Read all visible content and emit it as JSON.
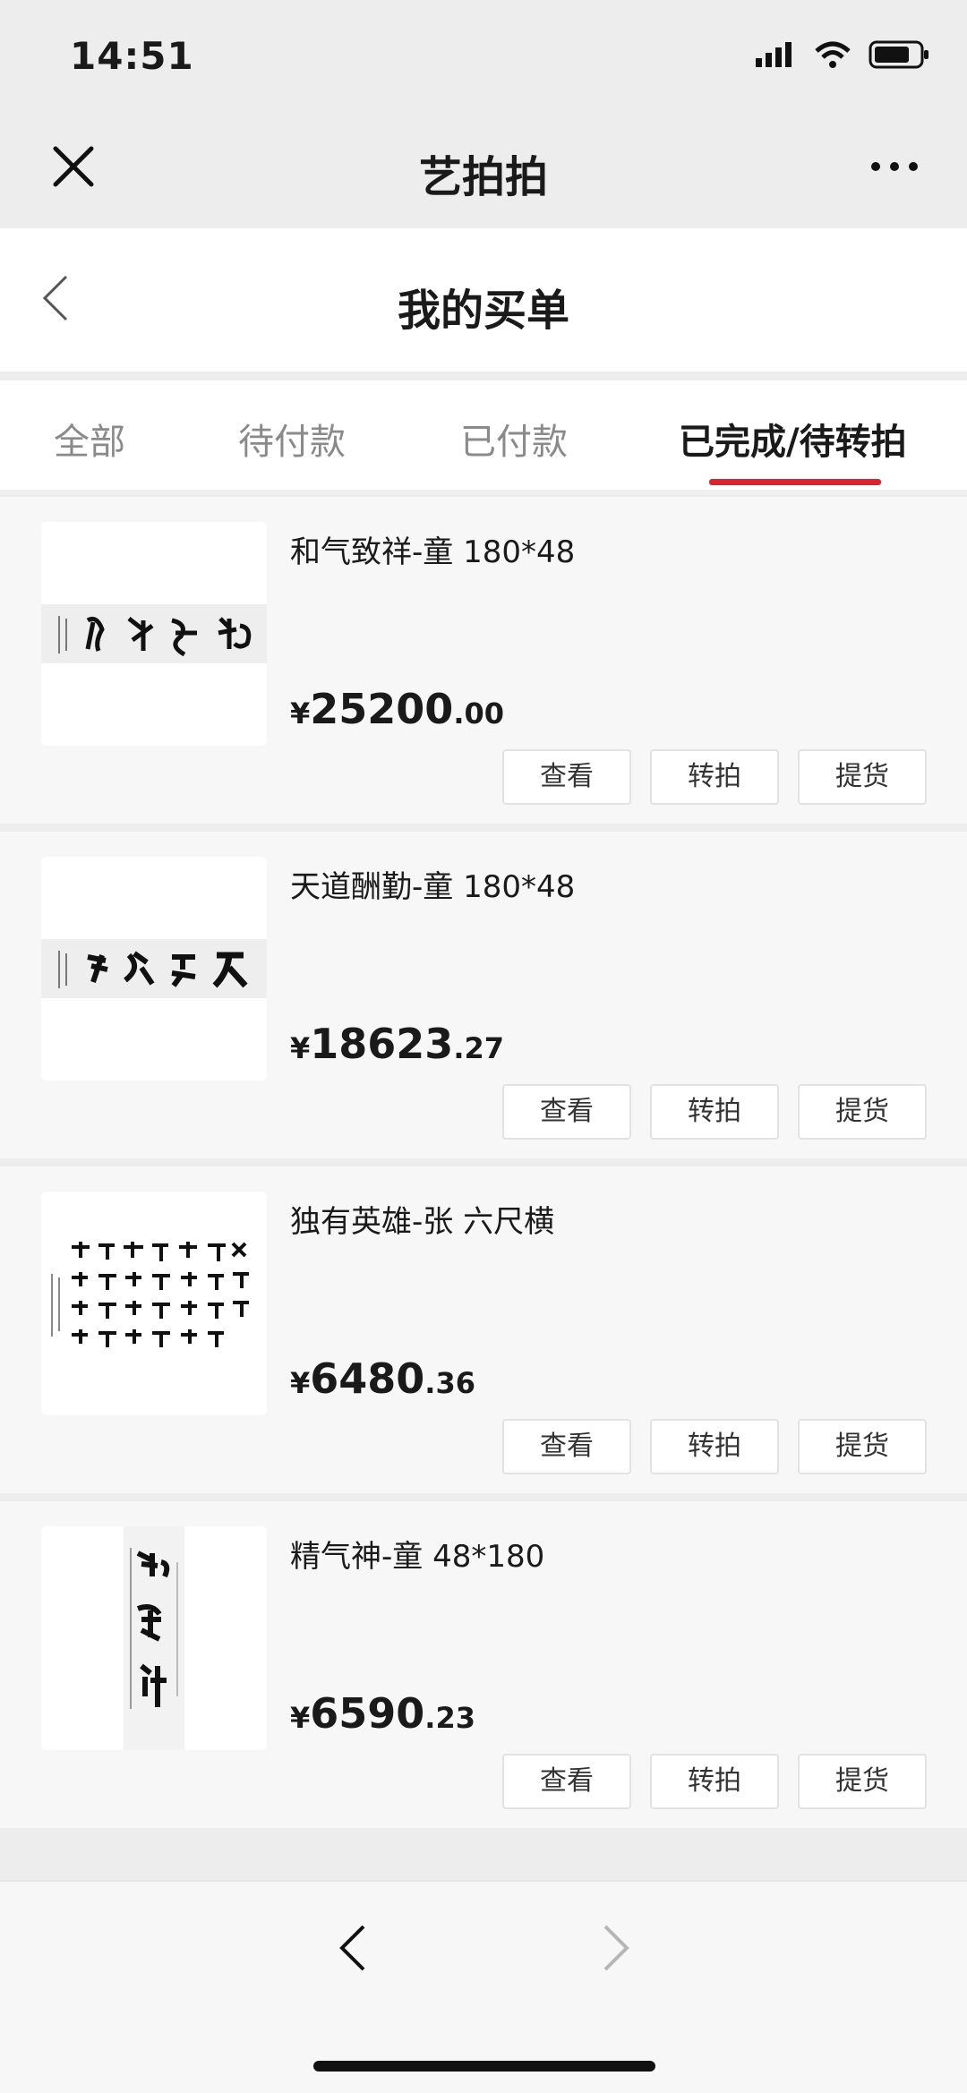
{
  "status_bar": {
    "time": "14:51"
  },
  "mini_program": {
    "title": "艺拍拍"
  },
  "header": {
    "title": "我的买单"
  },
  "tabs": [
    {
      "label": "全部",
      "active": false
    },
    {
      "label": "待付款",
      "active": false
    },
    {
      "label": "已付款",
      "active": false
    },
    {
      "label": "已完成/待转拍",
      "active": true
    }
  ],
  "orders": [
    {
      "name": "和气致祥-童 180*48",
      "currency": "¥",
      "price_int": "25200",
      "price_dec": ".00"
    },
    {
      "name": "天道酬勤-童 180*48",
      "currency": "¥",
      "price_int": "18623",
      "price_dec": ".27"
    },
    {
      "name": "独有英雄-张 六尺横",
      "currency": "¥",
      "price_int": "6480",
      "price_dec": ".36"
    },
    {
      "name": "精气神-童 48*180",
      "currency": "¥",
      "price_int": "6590",
      "price_dec": ".23"
    }
  ],
  "actions": {
    "view": "查看",
    "resale": "转拍",
    "pickup": "提货"
  },
  "colors": {
    "accent": "#d8252f",
    "background": "#ededed"
  }
}
